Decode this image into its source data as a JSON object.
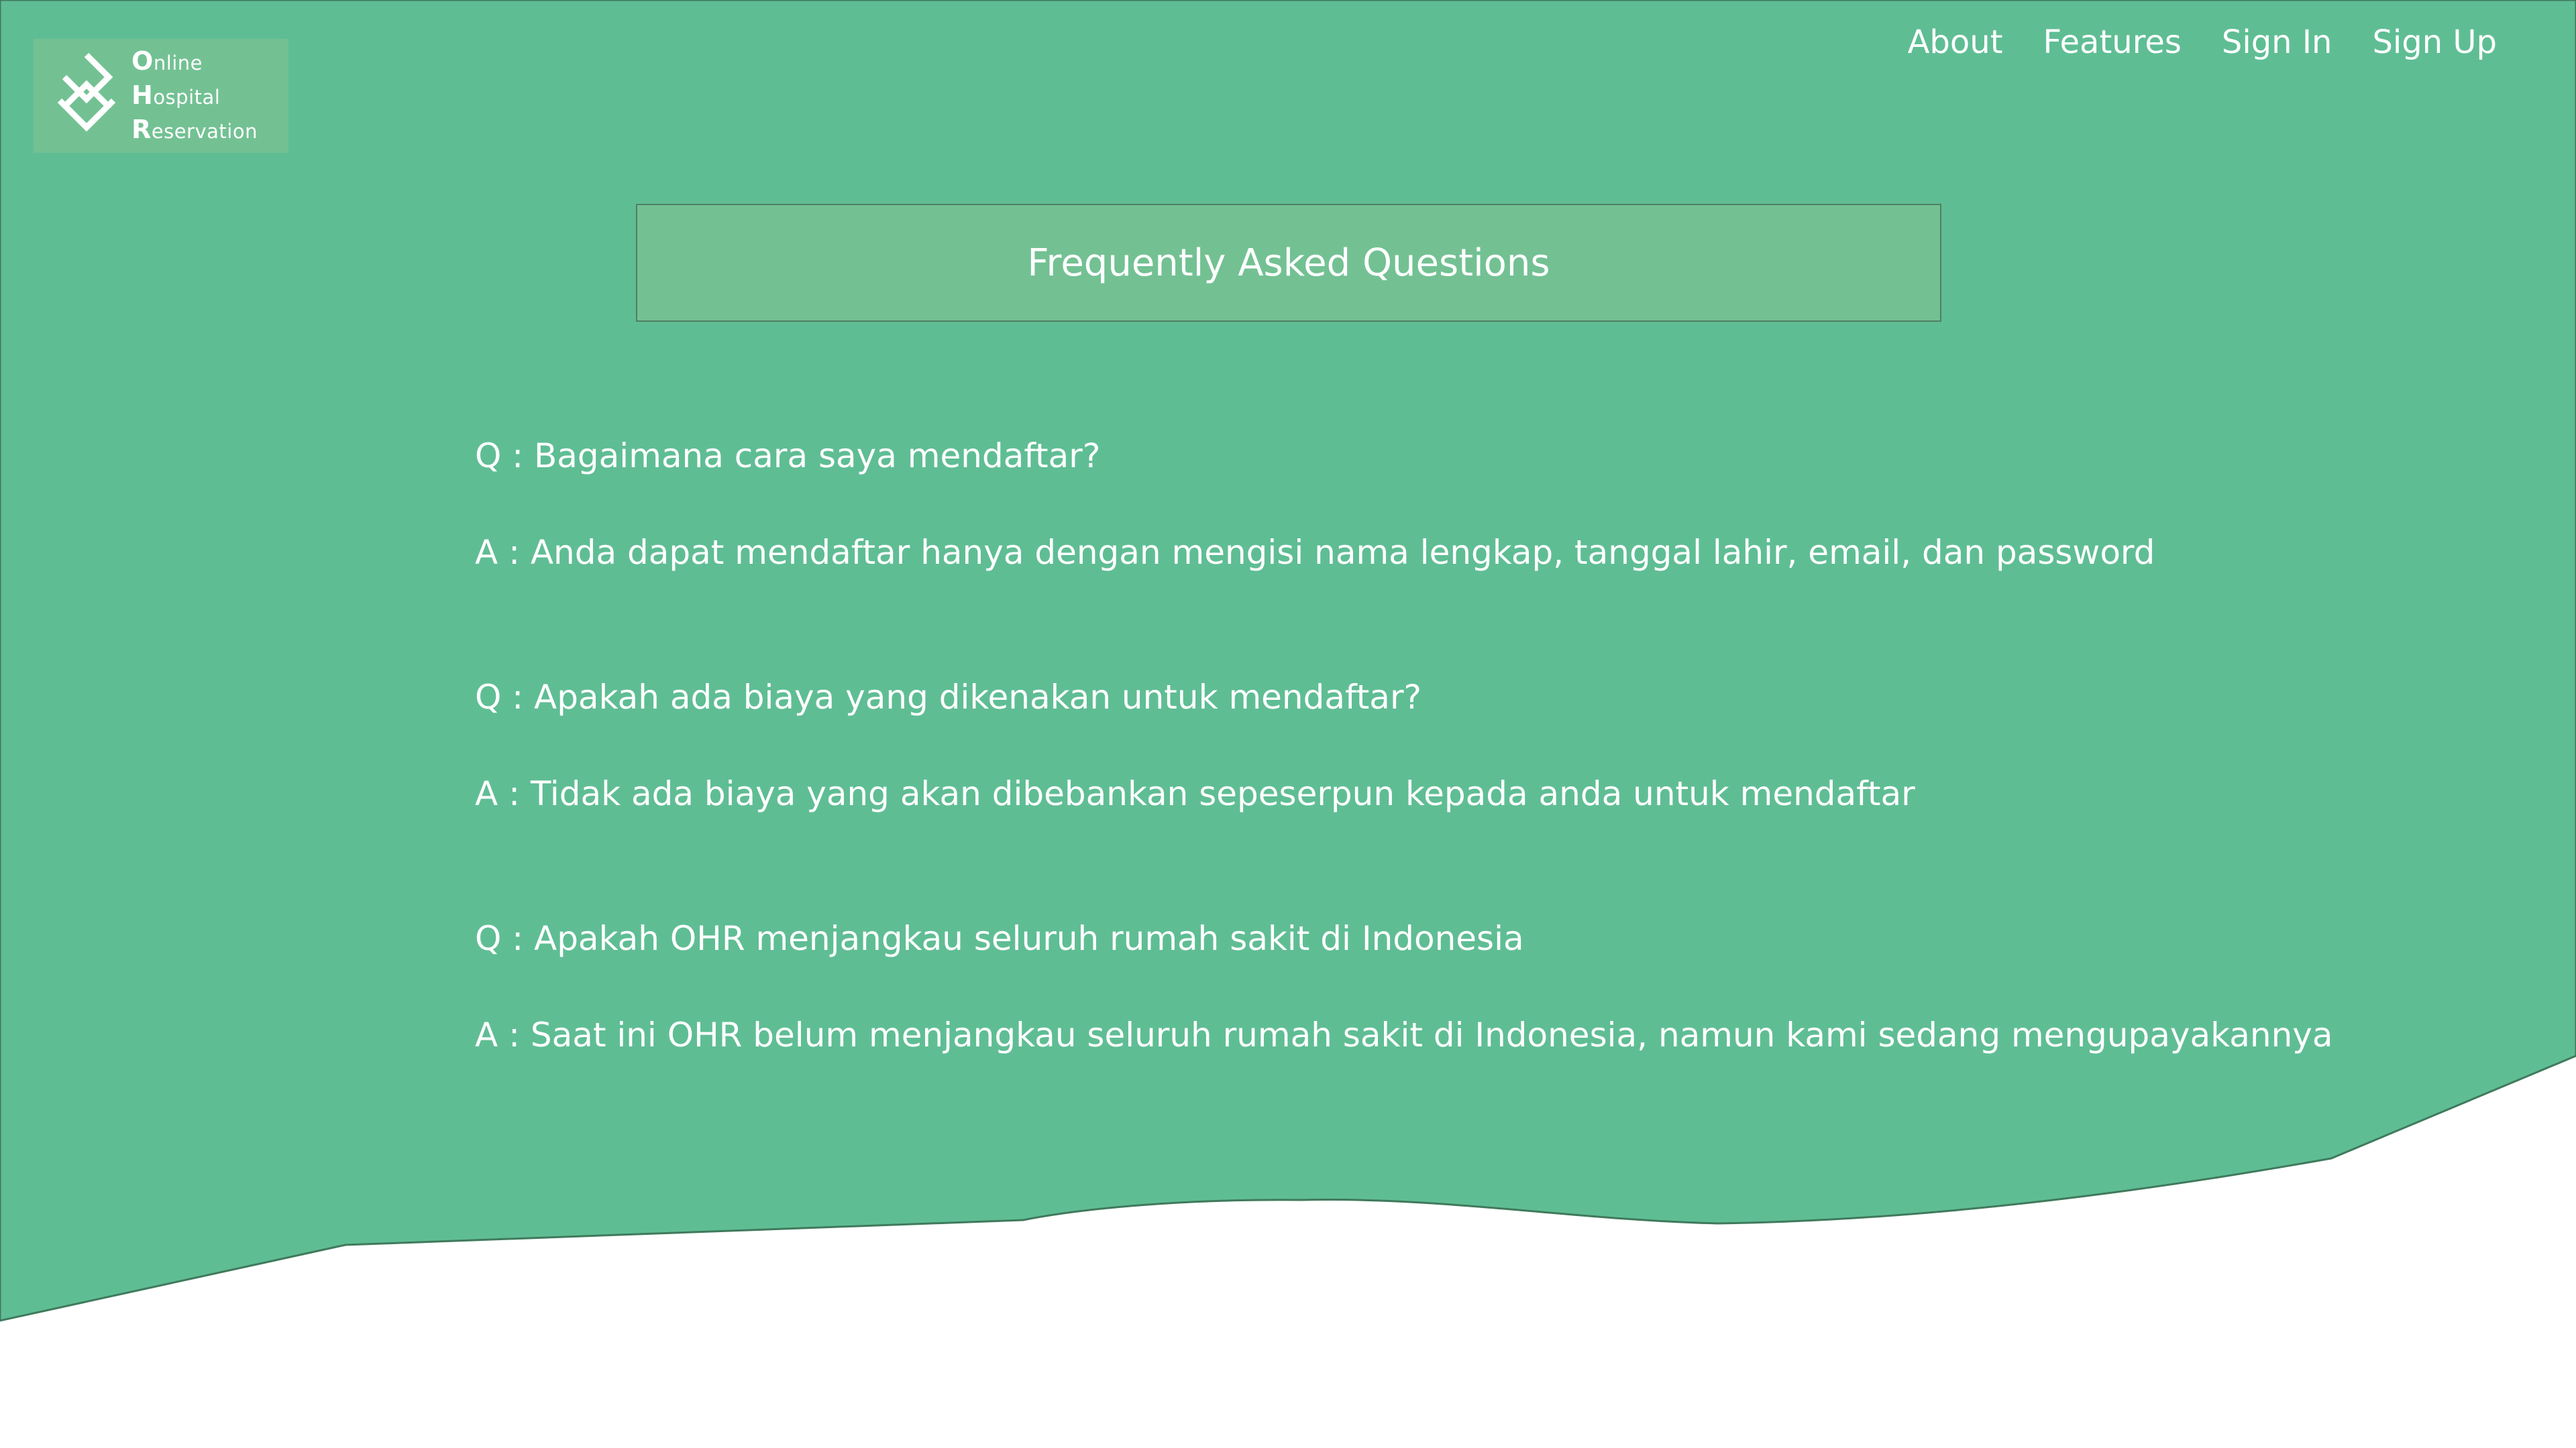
{
  "colors": {
    "primary_green": "#5fbd94",
    "box_green": "#73c193",
    "text": "#ffffff",
    "background": "#ffffff"
  },
  "logo": {
    "icon": "diamond-chevron-logo-icon",
    "lines": [
      {
        "initial": "O",
        "rest": "nline"
      },
      {
        "initial": "H",
        "rest": "ospital"
      },
      {
        "initial": "R",
        "rest": "eservation"
      }
    ]
  },
  "nav": {
    "about": "About",
    "features": "Features",
    "sign_in": "Sign In",
    "sign_up": "Sign Up"
  },
  "faq": {
    "title": "Frequently Asked Questions",
    "items": [
      {
        "question": "Q : Bagaimana cara saya mendaftar?",
        "answer": "A : Anda dapat mendaftar hanya dengan mengisi nama lengkap, tanggal lahir, email, dan password"
      },
      {
        "question": "Q : Apakah ada biaya yang dikenakan untuk mendaftar?",
        "answer": "A : Tidak ada biaya yang akan dibebankan sepeserpun kepada anda untuk mendaftar"
      },
      {
        "question": "Q : Apakah OHR menjangkau seluruh rumah sakit di Indonesia",
        "answer": "A : Saat ini OHR belum menjangkau seluruh rumah sakit di Indonesia, namun kami sedang mengupayakannya"
      }
    ]
  }
}
